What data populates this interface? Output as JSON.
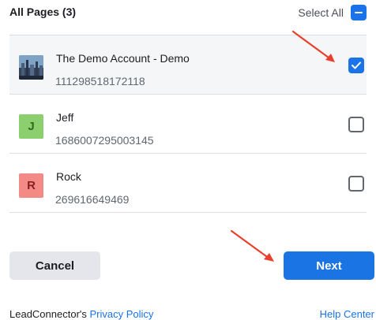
{
  "header": {
    "title": "All Pages (3)",
    "select_all_label": "Select All"
  },
  "pages": [
    {
      "name": "The Demo Account - Demo",
      "id": "111298518172118",
      "avatar": "city-photo",
      "selected": true
    },
    {
      "name": "Jeff",
      "id": "1686007295003145",
      "avatar_letter": "J",
      "avatar_color": "#8ccf6e",
      "selected": false
    },
    {
      "name": "Rock",
      "id": "269616649469",
      "avatar_letter": "R",
      "avatar_color": "#f48a85",
      "selected": false
    }
  ],
  "buttons": {
    "cancel_label": "Cancel",
    "next_label": "Next"
  },
  "footer": {
    "prefix": "LeadConnector's",
    "privacy_link": "Privacy Policy",
    "help_link": "Help Center"
  },
  "colors": {
    "accent": "#1b74e4",
    "annotation_arrow": "#e8402c"
  }
}
